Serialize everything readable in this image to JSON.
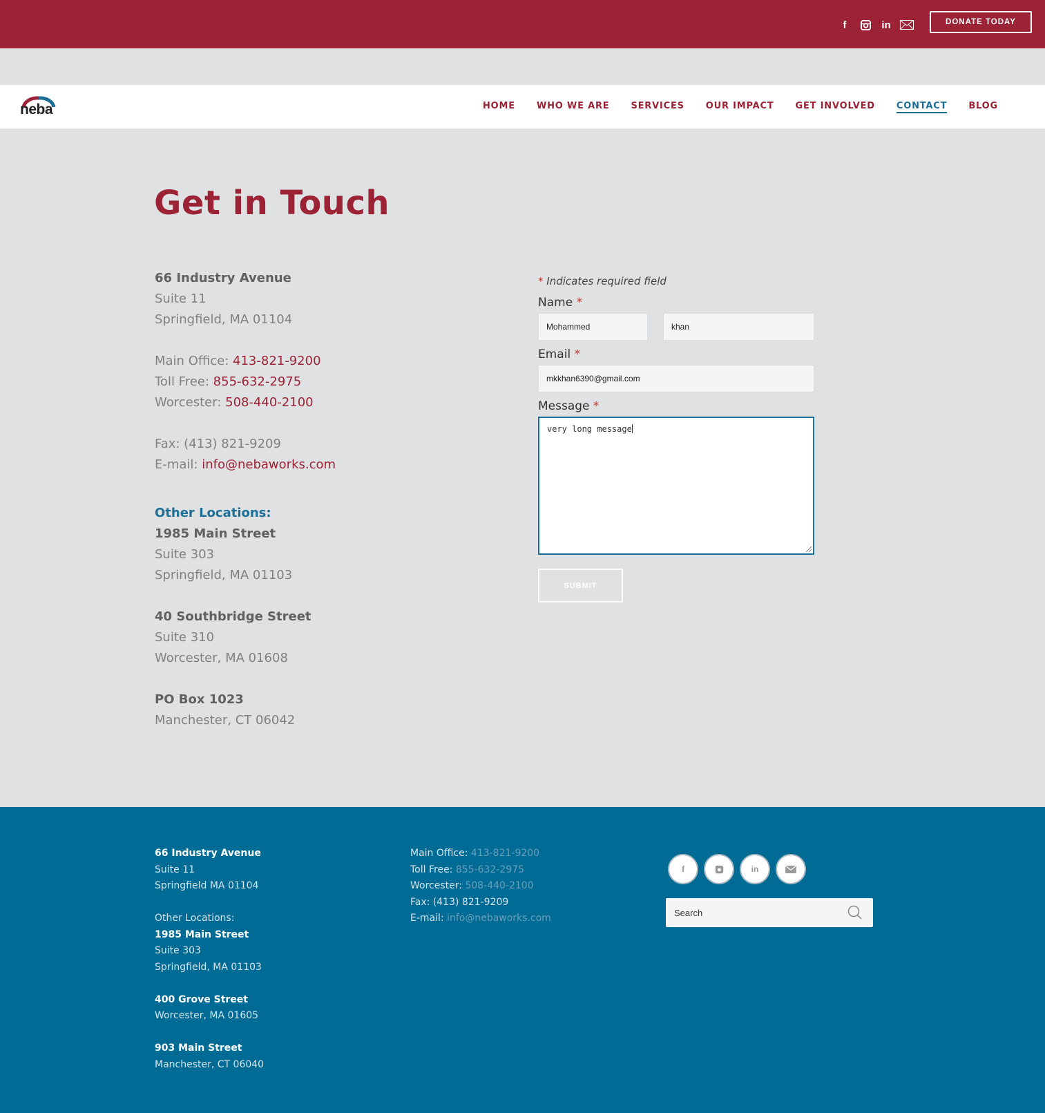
{
  "topbar": {
    "social": [
      "facebook-icon",
      "instagram-icon",
      "linkedin-icon",
      "email-icon"
    ],
    "donate_label": "DONATE TODAY"
  },
  "brand": {
    "logo_text": "neba"
  },
  "nav": {
    "items": [
      "HOME",
      "WHO WE ARE",
      "SERVICES",
      "OUR IMPACT",
      "GET INVOLVED",
      "CONTACT",
      "BLOG"
    ],
    "active": "CONTACT"
  },
  "main": {
    "title": "Get in Touch",
    "address": {
      "street": "66 Industry Avenue",
      "suite": "Suite 11",
      "city": "Springfield, MA 01104"
    },
    "phones": {
      "main_label": "Main Office:",
      "main": "413-821-9200",
      "tollfree_label": "Toll Free:",
      "tollfree": "855-632-2975",
      "worcester_label": "Worcester:",
      "worcester": "508-440-2100"
    },
    "fax": "Fax: (413) 821-9209",
    "email_label": "E-mail:",
    "email": "info@nebaworks.com",
    "other_heading": "Other Locations:",
    "locations": [
      {
        "street": "1985 Main Street",
        "suite": "Suite 303",
        "city": "Springfield, MA 01103"
      },
      {
        "street": "40 Southbridge Street",
        "suite": "Suite 310",
        "city": "Worcester, MA 01608"
      },
      {
        "street": "PO Box 1023",
        "city": "Manchester, CT 06042"
      }
    ]
  },
  "form": {
    "required_note": "Indicates required field",
    "required_mark": "*",
    "name_label": "Name",
    "first_name": "Mohammed",
    "last_name": "khan",
    "email_label": "Email",
    "email_value": "mkkhan6390@gmail.com",
    "message_label": "Message",
    "message_value": "very long message",
    "submit_label": "SUBMIT"
  },
  "footer": {
    "address": {
      "street": "66 Industry Avenue",
      "suite": "Suite 11",
      "city": "Springfield MA 01104"
    },
    "other_heading": "Other Locations:",
    "locations": [
      {
        "street": "1985 Main Street",
        "suite": "Suite 303",
        "city": "Springfield, MA 01103"
      },
      {
        "street": "400 Grove Street",
        "city": "Worcester, MA 01605"
      },
      {
        "street": "903 Main Street",
        "city": "Manchester, CT 06040"
      }
    ],
    "phones": {
      "main_label": "Main Office:",
      "main": "413-821-9200",
      "tollfree_label": "Toll Free:",
      "tollfree": "855-632-2975",
      "worcester_label": "Worcester:",
      "worcester": "508-440-2100"
    },
    "fax": "Fax: (413) 821-9209",
    "email_label": "E-mail:",
    "email": "info@nebaworks.com",
    "social": [
      "facebook-icon",
      "instagram-icon",
      "linkedin-icon",
      "email-icon"
    ],
    "search_placeholder": "Search"
  },
  "colors": {
    "brand_red": "#9b2335",
    "brand_blue": "#006c96",
    "page_bg": "#e0e1e3"
  }
}
